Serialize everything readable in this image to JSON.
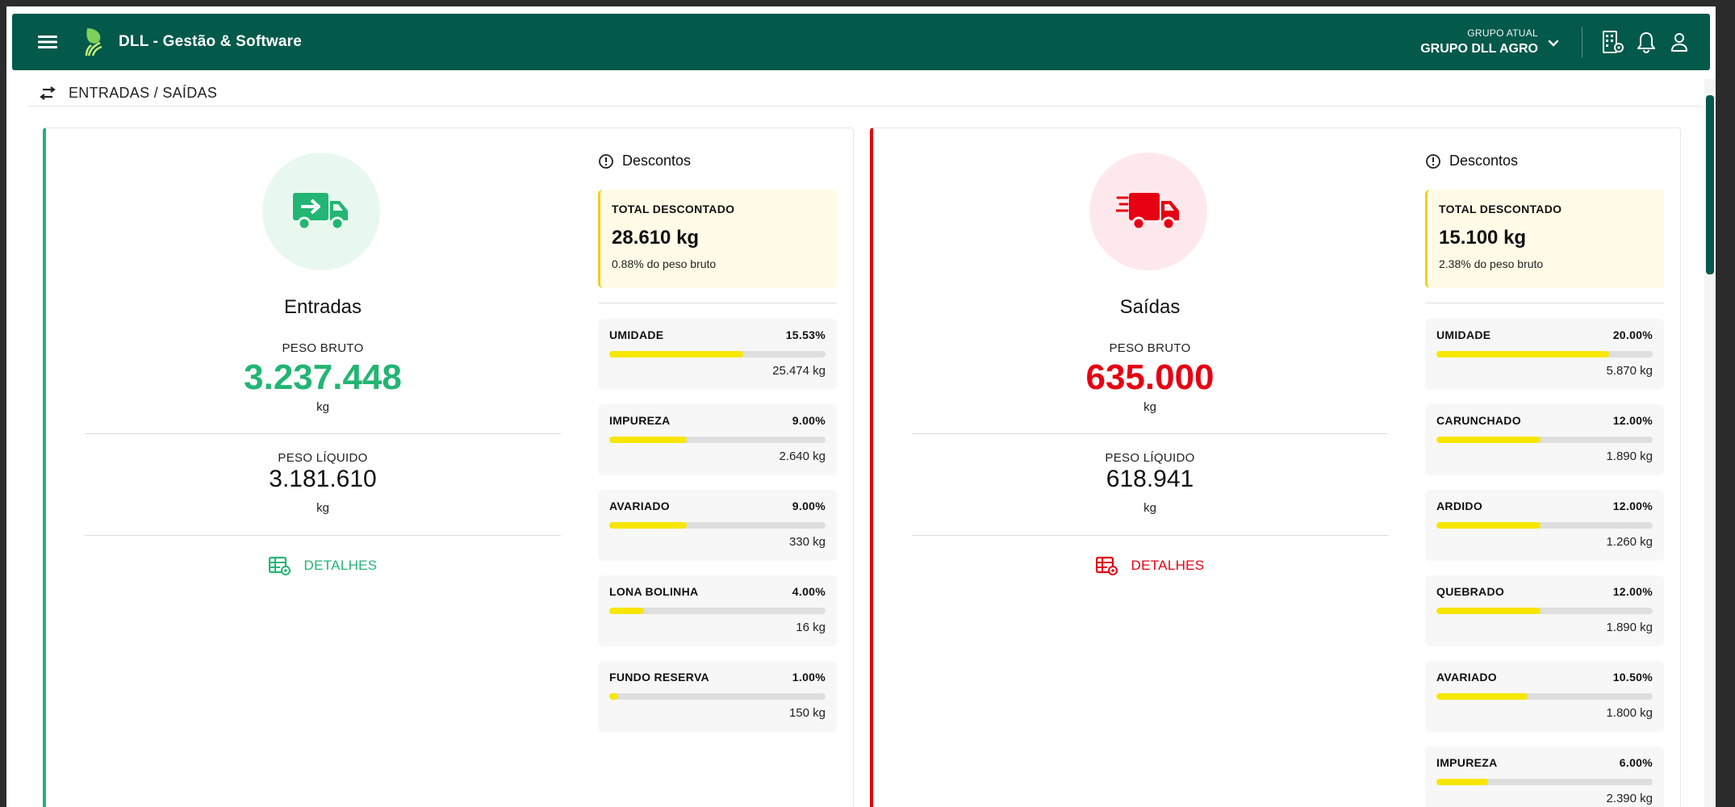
{
  "header": {
    "app_title": "DLL - Gestão & Software",
    "group_caption": "GRUPO ATUAL",
    "group_value": "GRUPO DLL AGRO",
    "brand_color": "#03594a",
    "icons": [
      "menu-icon",
      "logo-icon",
      "chevron-down-icon",
      "company-settings-icon",
      "bell-icon",
      "user-icon"
    ]
  },
  "breadcrumb": {
    "icon": "swap-arrows-icon",
    "text": "ENTRADAS / SAÍDAS"
  },
  "entradas": {
    "title": "Entradas",
    "accent": "#22b573",
    "icon": "truck-arrow-icon",
    "peso_bruto_label": "PESO BRUTO",
    "peso_bruto": "3.237.448",
    "unit": "kg",
    "peso_liquido_label": "PESO LÍQUIDO",
    "peso_liquido": "3.181.610",
    "details_label": "DETALHES",
    "descontos_label": "Descontos",
    "total_label": "TOTAL DESCONTADO",
    "total_value": "28.610 kg",
    "total_pct": "0.88% do peso bruto",
    "items": [
      {
        "name": "UMIDADE",
        "pct": "15.53%",
        "pct_value": 15.53,
        "kg": "25.474 kg"
      },
      {
        "name": "IMPUREZA",
        "pct": "9.00%",
        "pct_value": 9.0,
        "kg": "2.640 kg"
      },
      {
        "name": "AVARIADO",
        "pct": "9.00%",
        "pct_value": 9.0,
        "kg": "330 kg"
      },
      {
        "name": "LONA BOLINHA",
        "pct": "4.00%",
        "pct_value": 4.0,
        "kg": "16 kg"
      },
      {
        "name": "FUNDO RESERVA",
        "pct": "1.00%",
        "pct_value": 1.0,
        "kg": "150 kg"
      }
    ]
  },
  "saidas": {
    "title": "Saídas",
    "accent": "#e60012",
    "icon": "truck-fast-icon",
    "peso_bruto_label": "PESO BRUTO",
    "peso_bruto": "635.000",
    "unit": "kg",
    "peso_liquido_label": "PESO LÍQUIDO",
    "peso_liquido": "618.941",
    "details_label": "DETALHES",
    "descontos_label": "Descontos",
    "total_label": "TOTAL DESCONTADO",
    "total_value": "15.100 kg",
    "total_pct": "2.38% do peso bruto",
    "items": [
      {
        "name": "UMIDADE",
        "pct": "20.00%",
        "pct_value": 20.0,
        "kg": "5.870 kg"
      },
      {
        "name": "CARUNCHADO",
        "pct": "12.00%",
        "pct_value": 12.0,
        "kg": "1.890 kg"
      },
      {
        "name": "ARDIDO",
        "pct": "12.00%",
        "pct_value": 12.0,
        "kg": "1.260 kg"
      },
      {
        "name": "QUEBRADO",
        "pct": "12.00%",
        "pct_value": 12.0,
        "kg": "1.890 kg"
      },
      {
        "name": "AVARIADO",
        "pct": "10.50%",
        "pct_value": 10.5,
        "kg": "1.800 kg"
      },
      {
        "name": "IMPUREZA",
        "pct": "6.00%",
        "pct_value": 6.0,
        "kg": "2.390 kg"
      }
    ]
  }
}
